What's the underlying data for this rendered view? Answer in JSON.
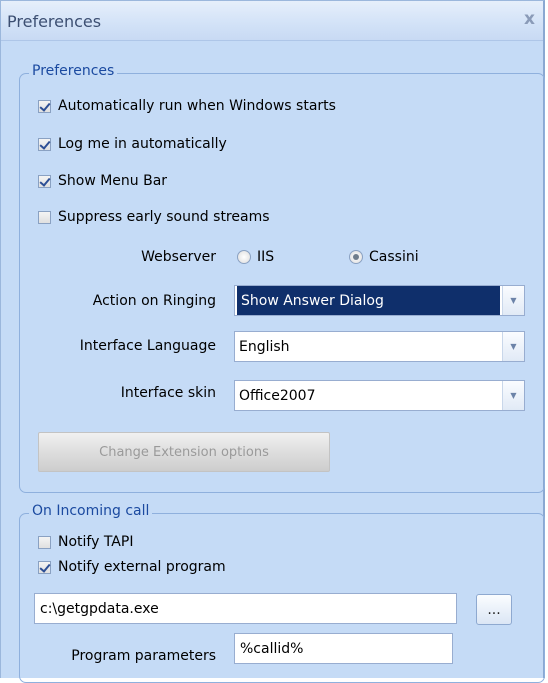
{
  "window": {
    "title": "Preferences",
    "close_glyph": "x"
  },
  "preferences": {
    "legend": "Preferences",
    "checkboxes": [
      {
        "label": "Automatically run when Windows starts",
        "checked": true
      },
      {
        "label": "Log me in automatically",
        "checked": true
      },
      {
        "label": "Show Menu Bar",
        "checked": true
      },
      {
        "label": "Suppress early sound streams",
        "checked": false
      }
    ],
    "webserver": {
      "label": "Webserver",
      "options": [
        "IIS",
        "Cassini"
      ],
      "selected": "Cassini"
    },
    "action_on_ringing": {
      "label": "Action on Ringing",
      "value": "Show Answer Dialog"
    },
    "interface_language": {
      "label": "Interface Language",
      "value": "English"
    },
    "interface_skin": {
      "label": "Interface skin",
      "value": "Office2007"
    },
    "change_extension_button": "Change Extension options"
  },
  "incoming_call": {
    "legend": "On Incoming call",
    "checkboxes": [
      {
        "label": "Notify TAPI",
        "checked": false
      },
      {
        "label": "Notify external program",
        "checked": true
      }
    ],
    "program_path": "c:\\getgpdata.exe",
    "browse_label": "...",
    "program_parameters_label": "Program parameters",
    "program_parameters_value": "%callid%"
  },
  "colors": {
    "frame_background": "#c5dbf6",
    "legend_text": "#1b4aa0",
    "selection": "#0f2f6b"
  }
}
